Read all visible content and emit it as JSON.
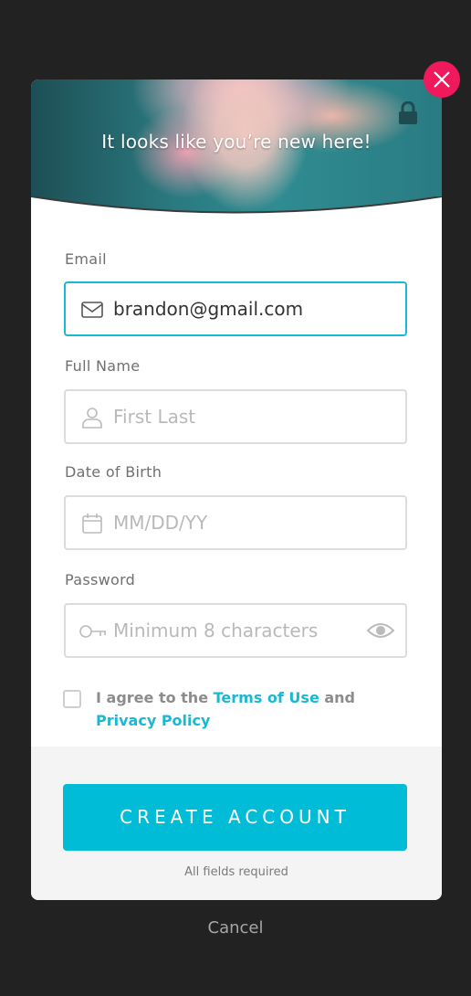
{
  "modal": {
    "hero_title": "It looks like you’re new here!",
    "hero_icons": [
      "lock-icon",
      "close-icon"
    ]
  },
  "form": {
    "email": {
      "label": "Email",
      "value": "brandon@gmail.com",
      "icon": "mail-icon"
    },
    "full_name": {
      "label": "Full Name",
      "placeholder": "First Last",
      "icon": "user-icon"
    },
    "dob": {
      "label": "Date of Birth",
      "placeholder": "MM/DD/YY",
      "icon": "calendar-icon"
    },
    "password": {
      "label": "Password",
      "placeholder": "Minimum 8 characters",
      "icon": "key-icon",
      "toggle_icon": "eye-icon"
    },
    "agree": {
      "prefix": "I agree to the ",
      "terms_link": "Terms of Use",
      "middle": " and",
      "privacy_link": "Privacy Policy",
      "checked": false
    }
  },
  "footer": {
    "create_label": "CREATE ACCOUNT",
    "required_note": "All fields required"
  },
  "cancel_label": "Cancel",
  "colors": {
    "accent": "#00bcd6",
    "link": "#1bb8d4",
    "close": "#f0195c",
    "overlay": "#222222"
  }
}
